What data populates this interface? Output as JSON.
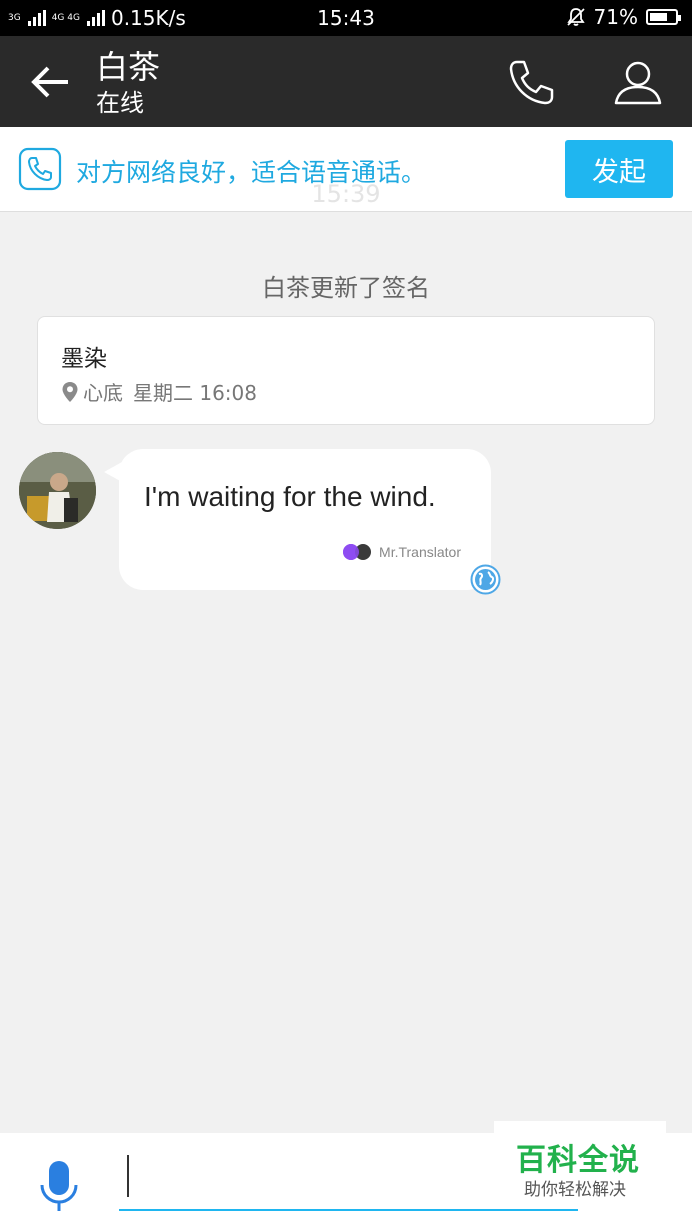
{
  "status_bar": {
    "network_left": "3G",
    "network_right": "4G 4G",
    "speed": "0.15K/s",
    "time": "15:43",
    "battery": "71%",
    "battery_level": 0.71
  },
  "header": {
    "title": "白茶",
    "subtitle": "在线"
  },
  "call_banner": {
    "text": "对方网络良好，适合语音通话。",
    "button": "发起",
    "accent": "#1fa9e0"
  },
  "chat": {
    "timestamp_faded": "15:39",
    "system_message": "白茶更新了签名",
    "signature_card": {
      "text": "墨染",
      "location": "心底",
      "time": "星期二 16:08"
    },
    "messages": [
      {
        "text": "I'm waiting for the wind.",
        "translator": "Mr.Translator"
      }
    ]
  },
  "watermark": {
    "title": "百科全说",
    "subtitle": "助你轻松解决"
  }
}
